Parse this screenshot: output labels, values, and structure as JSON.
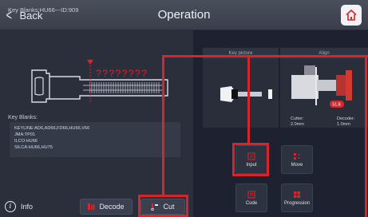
{
  "header": {
    "back_label": "Back",
    "title": "Operation"
  },
  "left": {
    "key_blank_id": "Key Blanks:HU66---ID:909",
    "question_marks": "????????",
    "key_blanks_label": "Key Blanks:",
    "key_blanks_lines": [
      "KEYLINE:AD6,AD66,FD66,HU66,V66",
      "JMA:TP01",
      "ILCO:HU66",
      "SILCA:HU66,HU75"
    ]
  },
  "bottom": {
    "info_label": "Info",
    "decode_label": "Decode",
    "cut_label": "Cut"
  },
  "right": {
    "key_picture_label": "Key picture",
    "align_label": "Align",
    "cutter_lines": [
      "Cutter:",
      "2.0mm"
    ],
    "decoder_lines": [
      "Decoder:",
      "1.0mm"
    ],
    "decoder_badge": "S1.B",
    "tiles": [
      {
        "label": "Input",
        "icon": "input-icon"
      },
      {
        "label": "Move",
        "icon": "move-icon"
      },
      {
        "label": "Code",
        "icon": "code-icon"
      },
      {
        "label": "Progression",
        "icon": "progression-icon"
      }
    ]
  },
  "colors": {
    "highlight_red": "#d6262b",
    "marker_red": "#e0202a",
    "background": "#1e2230",
    "panel": "#2b2f3c"
  }
}
